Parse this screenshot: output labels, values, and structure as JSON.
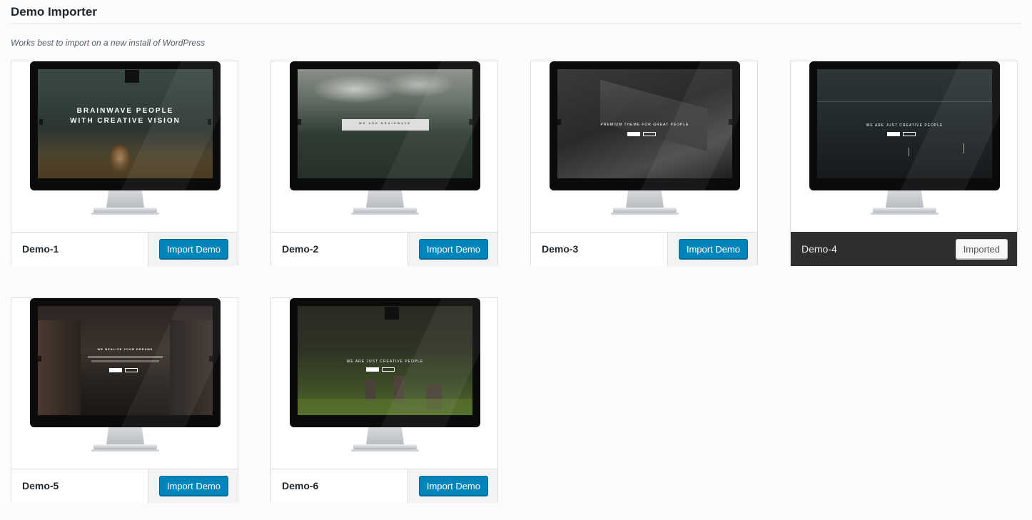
{
  "page": {
    "title": "Demo Importer",
    "subtitle": "Works best to import on a new install of WordPress"
  },
  "demos": [
    {
      "name": "Demo-1",
      "button": "Import Demo",
      "imported": false,
      "screen_text": "BRAINWAVE PEOPLE\nWITH CREATIVE VISION"
    },
    {
      "name": "Demo-2",
      "button": "Import Demo",
      "imported": false,
      "screen_text": "WE ARE BRAINWAVE"
    },
    {
      "name": "Demo-3",
      "button": "Import Demo",
      "imported": false,
      "screen_text": "PREMIUM THEME FOR GREAT PEOPLE"
    },
    {
      "name": "Demo-4",
      "button": "Imported",
      "imported": true,
      "screen_text": "WE ARE JUST CREATIVE PEOPLE"
    },
    {
      "name": "Demo-5",
      "button": "Import Demo",
      "imported": false,
      "screen_text": "WE REALIZE YOUR DREAMS"
    },
    {
      "name": "Demo-6",
      "button": "Import Demo",
      "imported": false,
      "screen_text": "WE ARE JUST CREATIVE PEOPLE"
    }
  ],
  "colors": {
    "primary_button": "#0085ba",
    "active_bar": "#2f2f2f"
  }
}
